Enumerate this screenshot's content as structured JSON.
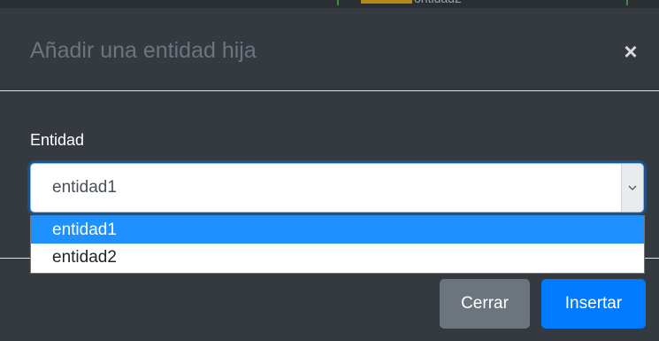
{
  "background_fragment": {
    "cut_text": "ontidad2"
  },
  "modal": {
    "title": "Añadir una entidad hija",
    "close_glyph": "×",
    "close_icon": "close-icon"
  },
  "form": {
    "entity_label": "Entidad",
    "entity_select": {
      "value": "entidad1",
      "options": [
        "entidad1",
        "entidad2"
      ],
      "highlighted_index": 0,
      "arrow_icon": "chevron-down-icon"
    }
  },
  "footer": {
    "close_label": "Cerrar",
    "insert_label": "Insertar"
  },
  "colors": {
    "modal_bg": "#343a40",
    "primary": "#007bff",
    "secondary": "#6c757d",
    "option_highlight": "#1e90ff"
  }
}
